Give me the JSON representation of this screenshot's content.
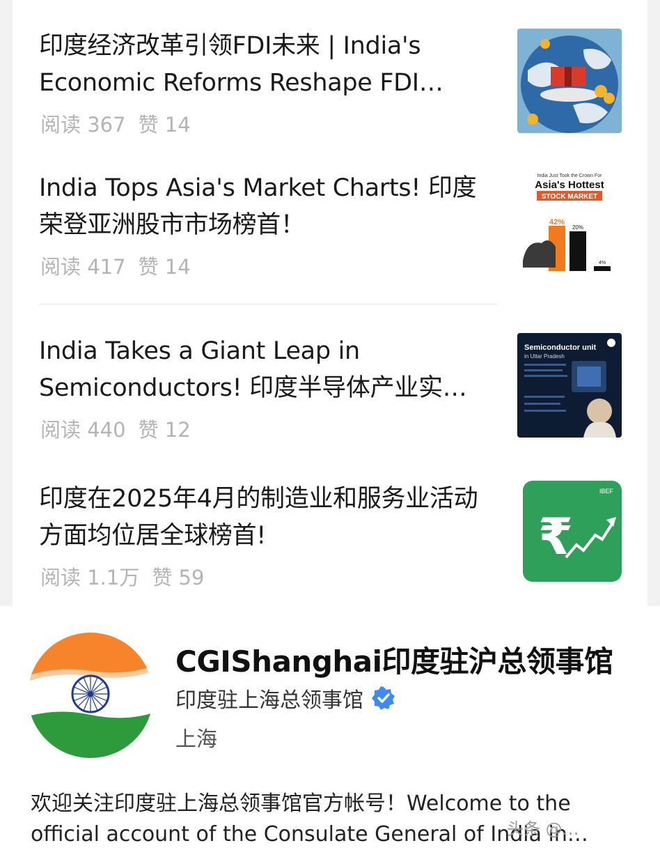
{
  "articles": [
    {
      "title": "印度经济改革引领FDI未来 | India's Economic Reforms Reshape FDI…",
      "reads": "阅读 367",
      "likes": "赞 14",
      "thumbnail": "fdi-illustration"
    },
    {
      "title": "India Tops Asia's Market Charts! 印度荣登亚洲股市市场榜首！",
      "reads": "阅读 417",
      "likes": "赞 14",
      "thumbnail": "stock-market-chart",
      "thumb_text": {
        "top": "India Just Took the Crown For",
        "headline": "Asia's Hottest",
        "tag": "STOCK MARKET",
        "pct1": "42%",
        "pct2": "20%",
        "pct3": "4%"
      }
    },
    {
      "title": "India Takes a Giant Leap in Semiconductors! 印度半导体产业实…",
      "reads": "阅读 440",
      "likes": "赞 12",
      "thumbnail": "semiconductor-poster",
      "thumb_text": {
        "headline": "Semiconductor unit",
        "sub": "in Uttar Pradesh"
      }
    },
    {
      "title": "印度在2025年4月的制造业和服务业活动方面均位居全球榜首!",
      "reads": "阅读 1.1万",
      "likes": "赞 59",
      "thumbnail": "rupee-growth",
      "thumb_text": {
        "brand": "IBEF",
        "symbol": "₹"
      }
    }
  ],
  "profile": {
    "name": "CGIShanghai印度驻沪总领事馆",
    "subtitle": "印度驻上海总领事馆",
    "location": "上海",
    "description": "欢迎关注印度驻上海总领事馆官方帐号！Welcome to the official account of the Consulate General of India in…",
    "avatar": "india-flag",
    "verified_color": "#3d8af7"
  },
  "watermark": "头条 @…"
}
